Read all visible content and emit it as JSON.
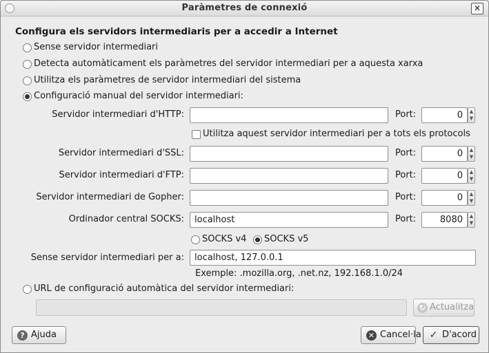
{
  "window": {
    "title": "Paràmetres de connexió",
    "close_glyph": "✕"
  },
  "heading": "Configura els servidors intermediaris per a accedir a Internet",
  "options": {
    "none": "Sense servidor intermediari",
    "auto_detect": "Detecta automàticament els paràmetres del servidor intermediari per a aquesta xarxa",
    "system": "Utilitza els paràmetres de servidor intermediari del sistema",
    "manual": "Configuració manual del servidor intermediari:",
    "pac_url": "URL de configuració automàtica del servidor intermediari:"
  },
  "selected_option": "manual",
  "manual": {
    "http_label": "Servidor intermediari d'HTTP:",
    "http_value": "",
    "ssl_label": "Servidor intermediari d'SSL:",
    "ssl_value": "",
    "ftp_label": "Servidor intermediari d'FTP:",
    "ftp_value": "",
    "gopher_label": "Servidor intermediari de Gopher:",
    "gopher_value": "",
    "socks_label": "Ordinador central SOCKS:",
    "socks_value": "localhost",
    "port_label": "Port:",
    "ports": {
      "http": "0",
      "ssl": "0",
      "ftp": "0",
      "gopher": "0",
      "socks": "8080"
    },
    "share_all_label": "Utilitza aquest servidor intermediari per a tots els protocols",
    "share_all_checked": false,
    "socks_v4": "SOCKS v4",
    "socks_v5": "SOCKS v5",
    "socks_selected": "v5",
    "no_proxy_label": "Sense servidor intermediari per a:",
    "no_proxy_value": "localhost, 127.0.0.1",
    "example": "Exemple: .mozilla.org, .net.nz, 192.168.1.0/24"
  },
  "pac": {
    "url_value": "",
    "reload_label": "Actualitza"
  },
  "buttons": {
    "help": "Ajuda",
    "cancel": "Cancel·la",
    "ok": "D'acord"
  },
  "spin_glyphs": {
    "up": "▲",
    "down": "▼"
  },
  "icons": {
    "help": "?",
    "cancel": "✕",
    "ok": "✓",
    "reload": "↻"
  }
}
